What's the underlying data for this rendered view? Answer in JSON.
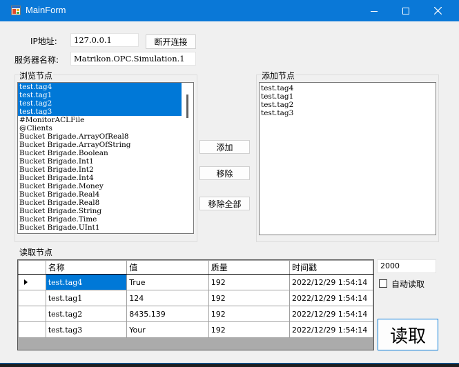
{
  "window": {
    "title": "MainForm",
    "minimize_icon": "minimize-icon",
    "maximize_icon": "maximize-icon",
    "close_icon": "close-icon"
  },
  "connection": {
    "ip_label": "IP地址:",
    "ip_value": "127.0.0.1",
    "disconnect_label": "断开连接",
    "server_label": "服务器名称:",
    "server_value": "Matrikon.OPC.Simulation.1"
  },
  "browse": {
    "title": "浏览节点",
    "items": [
      {
        "text": "test.tag4",
        "selected": true
      },
      {
        "text": "test.tag1",
        "selected": true
      },
      {
        "text": "test.tag2",
        "selected": true
      },
      {
        "text": "test.tag3",
        "selected": true
      },
      {
        "text": "#MonitorACLFile",
        "selected": false
      },
      {
        "text": "@Clients",
        "selected": false
      },
      {
        "text": "Bucket Brigade.ArrayOfReal8",
        "selected": false
      },
      {
        "text": "Bucket Brigade.ArrayOfString",
        "selected": false
      },
      {
        "text": "Bucket Brigade.Boolean",
        "selected": false
      },
      {
        "text": "Bucket Brigade.Int1",
        "selected": false
      },
      {
        "text": "Bucket Brigade.Int2",
        "selected": false
      },
      {
        "text": "Bucket Brigade.Int4",
        "selected": false
      },
      {
        "text": "Bucket Brigade.Money",
        "selected": false
      },
      {
        "text": "Bucket Brigade.Real4",
        "selected": false
      },
      {
        "text": "Bucket Brigade.Real8",
        "selected": false
      },
      {
        "text": "Bucket Brigade.String",
        "selected": false
      },
      {
        "text": "Bucket Brigade.Time",
        "selected": false
      },
      {
        "text": "Bucket Brigade.UInt1",
        "selected": false
      }
    ]
  },
  "actions": {
    "add_label": "添加",
    "remove_label": "移除",
    "remove_all_label": "移除全部"
  },
  "added": {
    "title": "添加节点",
    "items": [
      "test.tag4",
      "test.tag1",
      "test.tag2",
      "test.tag3"
    ]
  },
  "read": {
    "title": "读取节点",
    "columns": [
      "名称",
      "值",
      "质量",
      "时间戳"
    ],
    "rows": [
      {
        "name": "test.tag4",
        "value": "True",
        "quality": "192",
        "timestamp": "2022/12/29 1:54:14"
      },
      {
        "name": "test.tag1",
        "value": "124",
        "quality": "192",
        "timestamp": "2022/12/29 1:54:14"
      },
      {
        "name": "test.tag2",
        "value": "8435.139",
        "quality": "192",
        "timestamp": "2022/12/29 1:54:14"
      },
      {
        "name": "test.tag3",
        "value": "Your",
        "quality": "192",
        "timestamp": "2022/12/29 1:54:14"
      }
    ],
    "interval_value": "2000",
    "auto_read_label": "自动读取",
    "auto_read_checked": false,
    "read_button_label": "读取"
  },
  "colors": {
    "titlebar": "#0a78d7",
    "selection": "#0078d7"
  }
}
